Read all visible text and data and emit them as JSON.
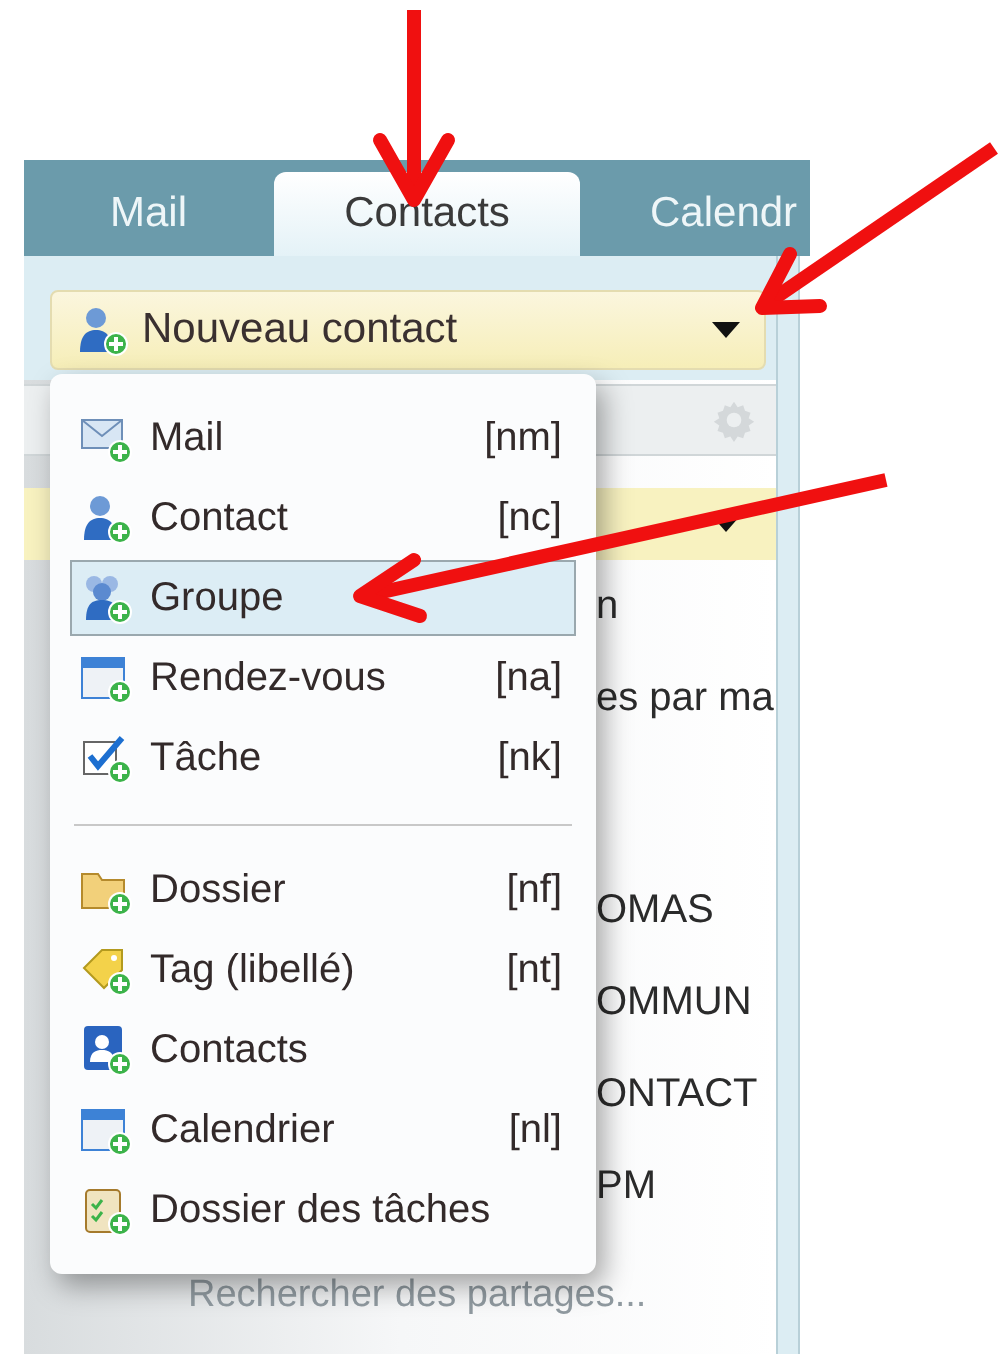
{
  "tabs": [
    {
      "label": "Mail",
      "selected": false
    },
    {
      "label": "Contacts",
      "selected": true
    },
    {
      "label": "Calendr",
      "selected": false
    }
  ],
  "new_button": {
    "label": "Nouveau contact"
  },
  "menu": {
    "items": [
      {
        "kind": "item",
        "label": "Mail",
        "shortcut": "[nm]",
        "selected": false
      },
      {
        "kind": "item",
        "label": "Contact",
        "shortcut": "[nc]",
        "selected": false
      },
      {
        "kind": "item",
        "label": "Groupe",
        "selected": true
      },
      {
        "kind": "item",
        "label": "Rendez-vous",
        "shortcut": "[na]",
        "selected": false
      },
      {
        "kind": "item",
        "label": "Tâche",
        "shortcut": "[nk]",
        "selected": false
      },
      {
        "kind": "separator"
      },
      {
        "kind": "item",
        "label": "Dossier",
        "shortcut": "[nf]",
        "selected": false
      },
      {
        "kind": "item",
        "label": "Tag (libellé)",
        "shortcut": "[nt]",
        "selected": false
      },
      {
        "kind": "item",
        "label": "Contacts",
        "selected": false
      },
      {
        "kind": "item",
        "label": "Calendrier",
        "shortcut": "[nl]",
        "selected": false
      },
      {
        "kind": "item",
        "label": "Dossier des tâches",
        "selected": false
      }
    ]
  },
  "background_panel": {
    "rows": [
      {
        "text": "n"
      },
      {
        "text": "es par ma"
      },
      {
        "text": "OMAS"
      },
      {
        "text": "OMMUN"
      },
      {
        "text": "ONTACT"
      },
      {
        "text": "PM"
      }
    ],
    "search_link": "Rechercher des partages..."
  }
}
